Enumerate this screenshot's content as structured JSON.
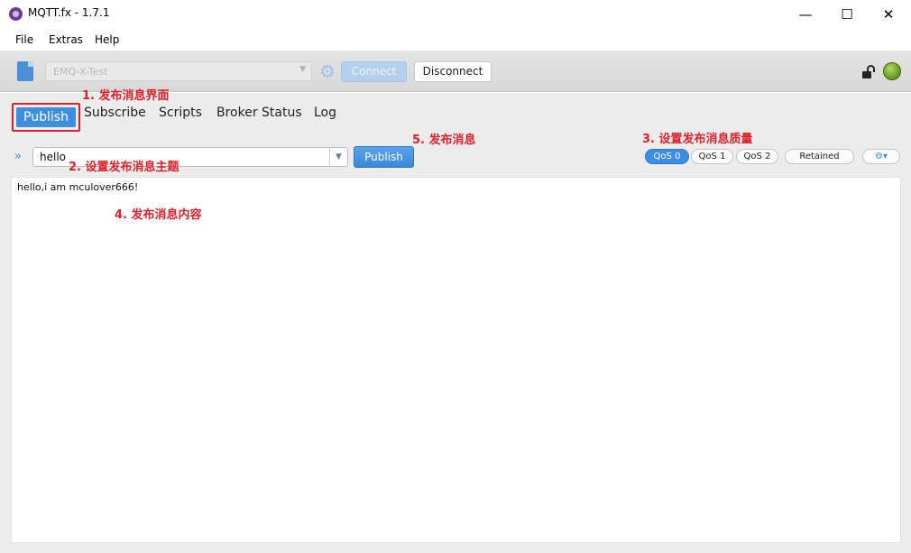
{
  "window": {
    "title": "MQTT.fx - 1.7.1",
    "minimize": "—",
    "maximize": "☐",
    "close": "✕"
  },
  "menu": [
    "File",
    "Extras",
    "Help"
  ],
  "toolbar": {
    "profile": "EMQ-X-Test",
    "connect_label": "Connect",
    "disconnect_label": "Disconnect",
    "status_color": "#6aa021"
  },
  "tabs": [
    "Publish",
    "Subscribe",
    "Scripts",
    "Broker Status",
    "Log"
  ],
  "publish": {
    "expand_icon": "»",
    "topic": "hello",
    "button_label": "Publish",
    "qos": [
      "QoS 0",
      "QoS 1",
      "QoS 2"
    ],
    "selected_qos": "QoS 0",
    "retained_label": "Retained",
    "options_icon": "⚙▾",
    "payload": "hello,i am mculover666!"
  },
  "annotations": {
    "a1": "1. 发布消息界面",
    "a2": "2. 设置发布消息主题",
    "a3": "3. 设置发布消息质量",
    "a4": "4. 发布消息内容",
    "a5": "5. 发布消息"
  },
  "colors": {
    "accent": "#3d8ee3",
    "annotation": "#e0202a"
  }
}
